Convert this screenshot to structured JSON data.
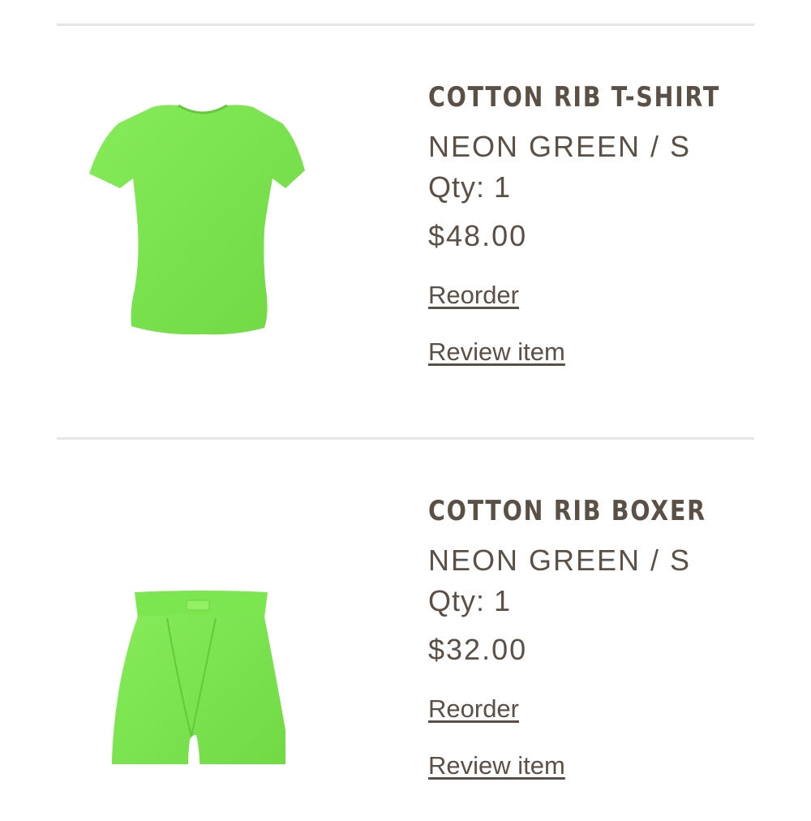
{
  "items": [
    {
      "name": "COTTON RIB T-SHIRT",
      "variant": "NEON GREEN / S",
      "qty": "Qty: 1",
      "price": "$48.00",
      "reorder_label": "Reorder",
      "review_label": "Review item",
      "image": "neon-green-tshirt",
      "color": "#7be44f"
    },
    {
      "name": "COTTON RIB BOXER",
      "variant": "NEON GREEN / S",
      "qty": "Qty: 1",
      "price": "$32.00",
      "reorder_label": "Reorder",
      "review_label": "Review item",
      "image": "neon-green-boxer",
      "color": "#7be44f"
    }
  ],
  "colors": {
    "text": "#5b5046",
    "divider": "#e6e6e6",
    "background": "#ffffff",
    "product_green": "#7be44f"
  }
}
